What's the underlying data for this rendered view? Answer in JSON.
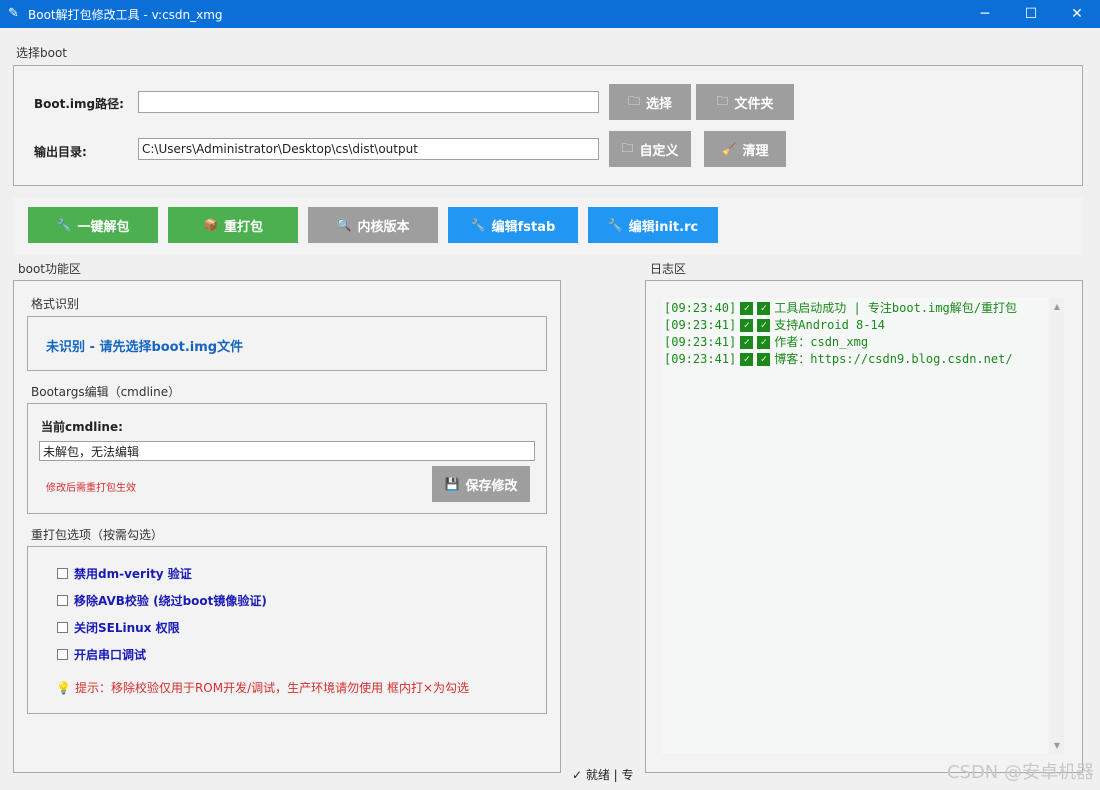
{
  "window": {
    "title": "Boot解打包修改工具 - v:csdn_xmg",
    "app_icon": "quill-icon",
    "minimize": "─",
    "maximize": "☐",
    "close": "✕"
  },
  "boot_select": {
    "group_title": "选择boot",
    "boot_path_label": "Boot.img路径:",
    "boot_path_value": "",
    "select_button": "选择",
    "folder_button": "文件夹",
    "output_label": "输出目录:",
    "output_value": "C:\\Users\\Administrator\\Desktop\\cs\\dist\\output",
    "custom_button": "自定义",
    "clean_button": "清理"
  },
  "actions": {
    "unpack": "一键解包",
    "repack": "重打包",
    "kernel_version": "内核版本",
    "edit_fstab": "编辑fstab",
    "edit_initrc": "编辑init.rc"
  },
  "boot_panel": {
    "group_title": "boot功能区",
    "format_title": "格式识别",
    "format_status": "未识别 - 请先选择boot.img文件",
    "bootargs_title": "Bootargs编辑（cmdline）",
    "cmdline_label": "当前cmdline:",
    "cmdline_value": "未解包，无法编辑",
    "cmdline_hint": "修改后需重打包生效",
    "save_button": "保存修改",
    "repack_title": "重打包选项（按需勾选）",
    "options": [
      "禁用dm-verity 验证",
      "移除AVB校验 (绕过boot镜像验证)",
      "关闭SELinux 权限",
      "开启串口调试"
    ],
    "tip": "提示：移除校验仅用于ROM开发/调试，生产环境请勿使用 框内打×为勾选"
  },
  "status_bar": {
    "text": "✓ 就绪 | 专"
  },
  "log": {
    "group_title": "日志区",
    "lines": [
      {
        "time": "[09:23:40]",
        "text": "工具启动成功 | 专注boot.img解包/重打包"
      },
      {
        "time": "[09:23:41]",
        "text": "支持Android 8-14"
      },
      {
        "time": "[09:23:41]",
        "text": "作者：csdn_xmg"
      },
      {
        "time": "[09:23:41]",
        "text": "博客：https://csdn9.blog.csdn.net/"
      }
    ]
  },
  "watermark": "CSDN @安卓机器",
  "colors": {
    "titlebar": "#0a6fd6",
    "green_button": "#4caf50",
    "blue_button": "#2196f3",
    "gray_button": "#9e9e9e",
    "log_text": "#1a8a1a",
    "format_status": "#1565c0",
    "option_text": "#1a1ab4",
    "warning_text": "#d32f2f"
  }
}
